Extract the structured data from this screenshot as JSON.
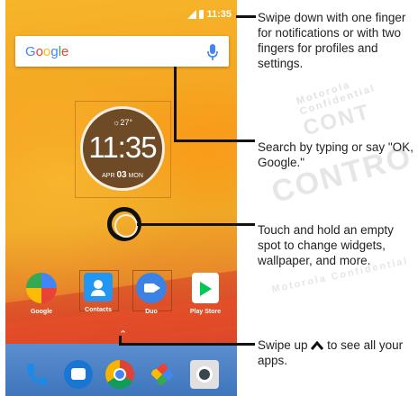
{
  "status_bar": {
    "time": "11:35"
  },
  "search": {
    "logo": "Google"
  },
  "clock": {
    "temperature": "27°",
    "time": "11:35",
    "month": "APR",
    "day": "03",
    "weekday": "MON"
  },
  "apps": [
    {
      "label": "Google"
    },
    {
      "label": "Contacts"
    },
    {
      "label": "Duo"
    },
    {
      "label": "Play Store"
    }
  ],
  "dock": {
    "icons": [
      "phone-icon",
      "messages-icon",
      "chrome-icon",
      "photos-icon",
      "camera-icon"
    ]
  },
  "callouts": [
    {
      "text": "Swipe down with one finger for notifications or with two fingers for profiles and settings."
    },
    {
      "text": "Search by typing or say \"OK, Google.\""
    },
    {
      "text": "Touch and hold an empty spot to change widgets, wallpaper, and more."
    },
    {
      "text_before": "Swipe up",
      "text_after": "to see all your apps."
    }
  ],
  "watermark": {
    "big": "CONTRO",
    "small": "Motorola Confidential"
  }
}
